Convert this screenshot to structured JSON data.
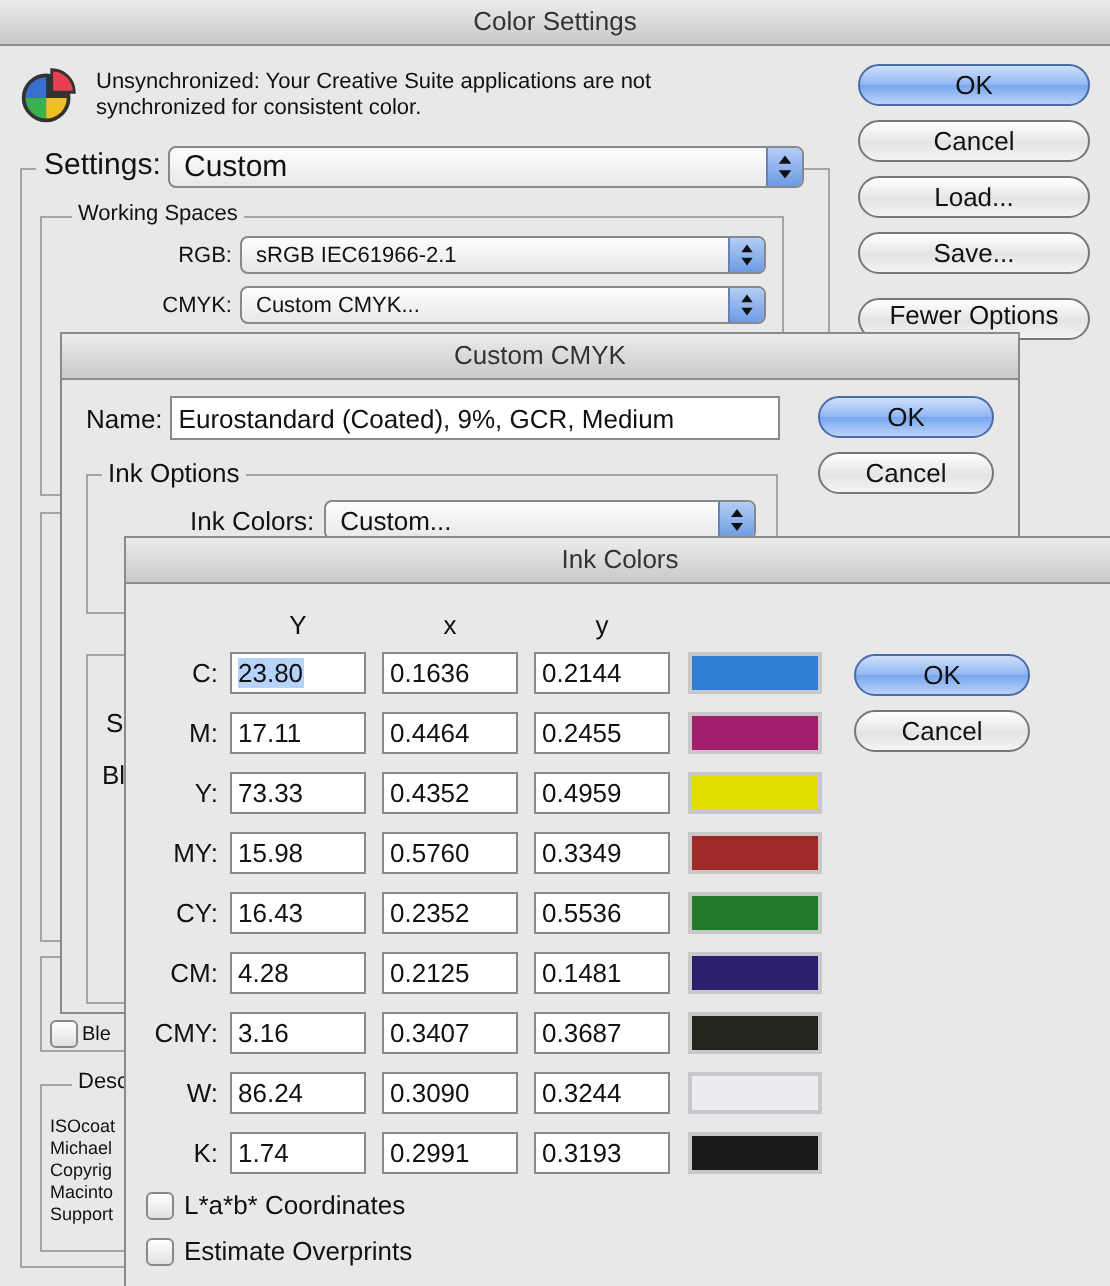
{
  "color_settings": {
    "title": "Color Settings",
    "message": "Unsynchronized: Your Creative Suite applications are not synchronized for consistent color.",
    "settings": {
      "label": "Settings:",
      "value": "Custom"
    },
    "working_spaces": {
      "legend": "Working Spaces",
      "rows": [
        {
          "label": "RGB:",
          "value": "sRGB IEC61966-2.1"
        },
        {
          "label": "CMYK:",
          "value": "Custom CMYK..."
        }
      ]
    },
    "checkbox": {
      "label": "Ble",
      "checked": false
    },
    "description": {
      "legend": "Desc",
      "lines": [
        "ISOcoat",
        "Michael",
        "Copyrig",
        "Macinto",
        "Support"
      ]
    },
    "buttons": [
      {
        "label": "OK",
        "default": true
      },
      {
        "label": "Cancel",
        "default": false
      },
      {
        "label": "Load...",
        "default": false
      },
      {
        "label": "Save...",
        "default": false
      },
      {
        "label": "Fewer Options",
        "default": false
      }
    ]
  },
  "custom_cmyk": {
    "title": "Custom CMYK",
    "name": {
      "label": "Name:",
      "value": "Eurostandard (Coated), 9%, GCR, Medium"
    },
    "ink_options": {
      "legend": "Ink Options",
      "label": "Ink Colors:",
      "value": "Custom..."
    },
    "separation_labels": [
      "S",
      "Bl"
    ],
    "buttons": [
      {
        "label": "OK",
        "default": true
      },
      {
        "label": "Cancel",
        "default": false
      }
    ]
  },
  "ink_colors": {
    "title": "Ink Colors",
    "columns": [
      "Y",
      "x",
      "y"
    ],
    "rows": [
      {
        "label": "C:",
        "color": "#2f7fd4",
        "fields": [
          {
            "value": "23.80",
            "selected": true
          },
          {
            "value": "0.1636",
            "selected": false
          },
          {
            "value": "0.2144",
            "selected": false
          }
        ]
      },
      {
        "label": "M:",
        "color": "#a11f6c",
        "fields": [
          {
            "value": "17.11",
            "selected": false
          },
          {
            "value": "0.4464",
            "selected": false
          },
          {
            "value": "0.2455",
            "selected": false
          }
        ]
      },
      {
        "label": "Y:",
        "color": "#e2df00",
        "fields": [
          {
            "value": "73.33",
            "selected": false
          },
          {
            "value": "0.4352",
            "selected": false
          },
          {
            "value": "0.4959",
            "selected": false
          }
        ]
      },
      {
        "label": "MY:",
        "color": "#9e2a27",
        "fields": [
          {
            "value": "15.98",
            "selected": false
          },
          {
            "value": "0.5760",
            "selected": false
          },
          {
            "value": "0.3349",
            "selected": false
          }
        ]
      },
      {
        "label": "CY:",
        "color": "#247a2a",
        "fields": [
          {
            "value": "16.43",
            "selected": false
          },
          {
            "value": "0.2352",
            "selected": false
          },
          {
            "value": "0.5536",
            "selected": false
          }
        ]
      },
      {
        "label": "CM:",
        "color": "#2b1f6e",
        "fields": [
          {
            "value": "4.28",
            "selected": false
          },
          {
            "value": "0.2125",
            "selected": false
          },
          {
            "value": "0.1481",
            "selected": false
          }
        ]
      },
      {
        "label": "CMY:",
        "color": "#25251e",
        "fields": [
          {
            "value": "3.16",
            "selected": false
          },
          {
            "value": "0.3407",
            "selected": false
          },
          {
            "value": "0.3687",
            "selected": false
          }
        ]
      },
      {
        "label": "W:",
        "color": "#ecedf3",
        "fields": [
          {
            "value": "86.24",
            "selected": false
          },
          {
            "value": "0.3090",
            "selected": false
          },
          {
            "value": "0.3244",
            "selected": false
          }
        ]
      },
      {
        "label": "K:",
        "color": "#1a1a1a",
        "fields": [
          {
            "value": "1.74",
            "selected": false
          },
          {
            "value": "0.2991",
            "selected": false
          },
          {
            "value": "0.3193",
            "selected": false
          }
        ]
      }
    ],
    "checkboxes": [
      {
        "label": "L*a*b* Coordinates",
        "checked": false
      },
      {
        "label": "Estimate Overprints",
        "checked": false
      }
    ],
    "buttons": [
      {
        "label": "OK",
        "default": true
      },
      {
        "label": "Cancel",
        "default": false
      }
    ]
  }
}
